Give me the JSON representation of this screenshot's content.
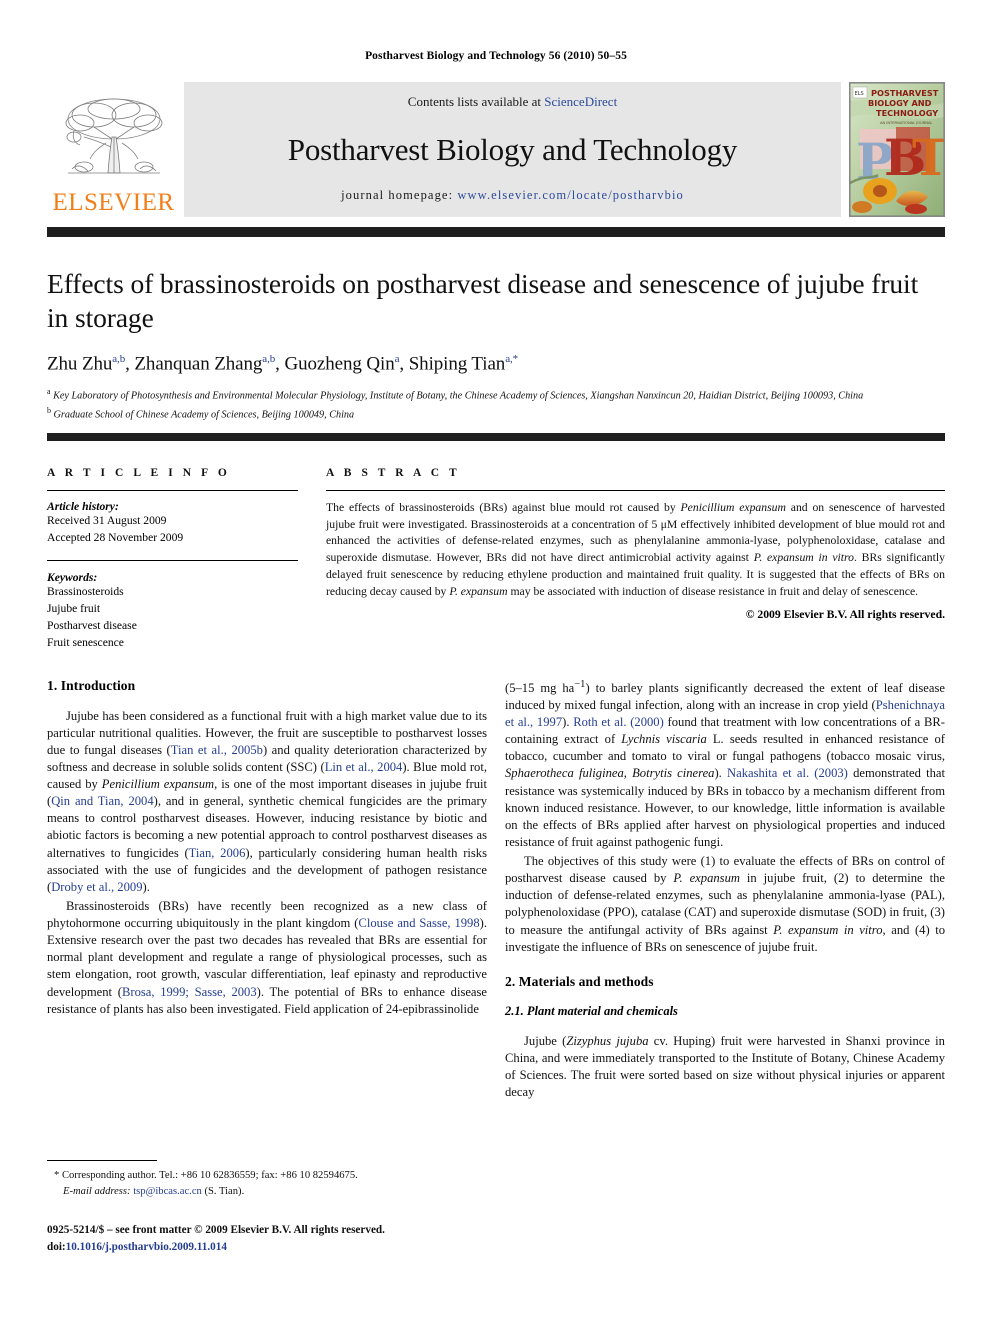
{
  "running_head": "Postharvest Biology and Technology 56 (2010) 50–55",
  "masthead": {
    "publisher_name": "ELSEVIER",
    "contents_prefix": "Contents lists available at ",
    "contents_link": "ScienceDirect",
    "journal_name": "Postharvest Biology and Technology",
    "homepage_prefix": "journal homepage: ",
    "homepage_url": "www.elsevier.com/locate/postharvbio",
    "cover_title_line1": "POSTHARVEST",
    "cover_title_line2": "BIOLOGY AND",
    "cover_title_line3": "TECHNOLOGY",
    "cover_letters": "PBT"
  },
  "title": "Effects of brassinosteroids on postharvest disease and senescence of jujube fruit in storage",
  "authors": {
    "a1_name": "Zhu Zhu",
    "a1_sup": "a,b",
    "a2_name": "Zhanquan Zhang",
    "a2_sup": "a,b",
    "a3_name": "Guozheng Qin",
    "a3_sup": "a",
    "a4_name": "Shiping Tian",
    "a4_sup": "a,*"
  },
  "affiliations": {
    "a_sup": "a",
    "a_text": "Key Laboratory of Photosynthesis and Environmental Molecular Physiology, Institute of Botany, the Chinese Academy of Sciences, Xiangshan Nanxincun 20, Haidian District, Beijing 100093, China",
    "b_sup": "b",
    "b_text": "Graduate School of Chinese Academy of Sciences, Beijing 100049, China"
  },
  "article_info": {
    "heading": "A R T I C L E    I N F O",
    "history_label": "Article history:",
    "received": "Received 31 August 2009",
    "accepted": "Accepted 28 November 2009",
    "keywords_label": "Keywords:",
    "keywords": [
      "Brassinosteroids",
      "Jujube fruit",
      "Postharvest disease",
      "Fruit senescence"
    ]
  },
  "abstract": {
    "heading": "A B S T R A C T",
    "p1_seg1": "The effects of brassinosteroids (BRs) against blue mould rot caused by ",
    "p1_it1": "Penicillium expansum",
    "p1_seg2": " and on senescence of harvested jujube fruit were investigated. Brassinosteroids at a concentration of 5 μM effectively inhibited development of blue mould rot and enhanced the activities of defense-related enzymes, such as phenylalanine ammonia-lyase, polyphenoloxidase, catalase and superoxide dismutase. However, BRs did not have direct antimicrobial activity against ",
    "p1_it2": "P. expansum in vitro",
    "p1_seg3": ". BRs significantly delayed fruit senescence by reducing ethylene production and maintained fruit quality. It is suggested that the effects of BRs on reducing decay caused by ",
    "p1_it3": "P. expansum",
    "p1_seg4": " may be associated with induction of disease resistance in fruit and delay of senescence.",
    "copyright": "© 2009 Elsevier B.V. All rights reserved."
  },
  "body": {
    "intro_heading": "1.  Introduction",
    "intro_p1_a": "Jujube has been considered as a functional fruit with a high market value due to its particular nutritional qualities. However, the fruit are susceptible to postharvest losses due to fungal diseases (",
    "intro_p1_ref1": "Tian et al., 2005b",
    "intro_p1_b": ") and quality deterioration characterized by softness and decrease in soluble solids content (SSC) (",
    "intro_p1_ref2": "Lin et al., 2004",
    "intro_p1_c": "). Blue mold rot, caused by ",
    "intro_p1_it1": "Penicillium expansum",
    "intro_p1_d": ", is one of the most important diseases in jujube fruit (",
    "intro_p1_ref3": "Qin and Tian, 2004",
    "intro_p1_e": "), and in general, synthetic chemical fungicides are the primary means to control postharvest diseases. However, inducing resistance by biotic and abiotic factors is becoming a new potential approach to control postharvest diseases as alternatives to fungicides (",
    "intro_p1_ref4": "Tian, 2006",
    "intro_p1_f": "), particularly considering human health risks associated with the use of fungicides and the development of pathogen resistance (",
    "intro_p1_ref5": "Droby et al., 2009",
    "intro_p1_g": ").",
    "intro_p2_a": "Brassinosteroids (BRs) have recently been recognized as a new class of phytohormone occurring ubiquitously in the plant kingdom (",
    "intro_p2_ref1": "Clouse and Sasse, 1998",
    "intro_p2_b": "). Extensive research over the past two decades has revealed that BRs are essential for normal plant development and regulate a range of physiological processes, such as stem elongation, root growth, vascular differentiation, leaf epinasty and reproductive development (",
    "intro_p2_ref2": "Brosa, 1999; Sasse, 2003",
    "intro_p2_c": "). The potential of BRs to enhance disease resistance of plants has also been investigated. Field application of 24-epibrassinolide",
    "right_p1_a": "(5–15 mg ha",
    "right_p1_sup": "−1",
    "right_p1_b": ") to barley plants significantly decreased the extent of leaf disease induced by mixed fungal infection, along with an increase in crop yield (",
    "right_p1_ref1": "Pshenichnaya et al., 1997",
    "right_p1_c": "). ",
    "right_p1_ref2": "Roth et al. (2000)",
    "right_p1_d": " found that treatment with low concentrations of a BR-containing extract of ",
    "right_p1_it1": "Lychnis viscaria",
    "right_p1_e": " L. seeds resulted in enhanced resistance of tobacco, cucumber and tomato to viral or fungal pathogens (tobacco mosaic virus, ",
    "right_p1_it2": "Sphaerotheca fuliginea, Botrytis cinerea",
    "right_p1_f": "). ",
    "right_p1_ref3": "Nakashita et al. (2003)",
    "right_p1_g": " demonstrated that resistance was systemically induced by BRs in tobacco by a mechanism different from known induced resistance. However, to our knowledge, little information is available on the effects of BRs applied after harvest on physiological properties and induced resistance of fruit against pathogenic fungi.",
    "right_p2_a": "The objectives of this study were (1) to evaluate the effects of BRs on control of postharvest disease caused by ",
    "right_p2_it1": "P. expansum",
    "right_p2_b": " in jujube fruit, (2) to determine the induction of defense-related enzymes, such as phenylalanine ammonia-lyase (PAL), polyphenoloxidase (PPO), catalase (CAT) and superoxide dismutase (SOD) in fruit, (3) to measure the antifungal activity of BRs against ",
    "right_p2_it2": "P. expansum in vitro",
    "right_p2_c": ", and (4) to investigate the influence of BRs on senescence of jujube fruit.",
    "methods_heading": "2.  Materials and methods",
    "methods_sub_heading": "2.1.  Plant material and chemicals",
    "methods_p1_a": "Jujube (",
    "methods_p1_it1": "Zizyphus jujuba",
    "methods_p1_b": " cv. Huping) fruit were harvested in Shanxi province in China, and were immediately transported to the Institute of Botany, Chinese Academy of Sciences. The fruit were sorted based on size without physical injuries or apparent decay"
  },
  "footnote": {
    "star": "*",
    "corresponding": " Corresponding author. Tel.: +86 10 62836559; fax: +86 10 82594675.",
    "email_label": "E-mail address:",
    "email": "tsp@ibcas.ac.cn",
    "email_suffix": " (S. Tian).",
    "issn_line": "0925-5214/$ – see front matter © 2009 Elsevier B.V. All rights reserved.",
    "doi_label": "doi:",
    "doi": "10.1016/j.postharvbio.2009.11.014"
  }
}
